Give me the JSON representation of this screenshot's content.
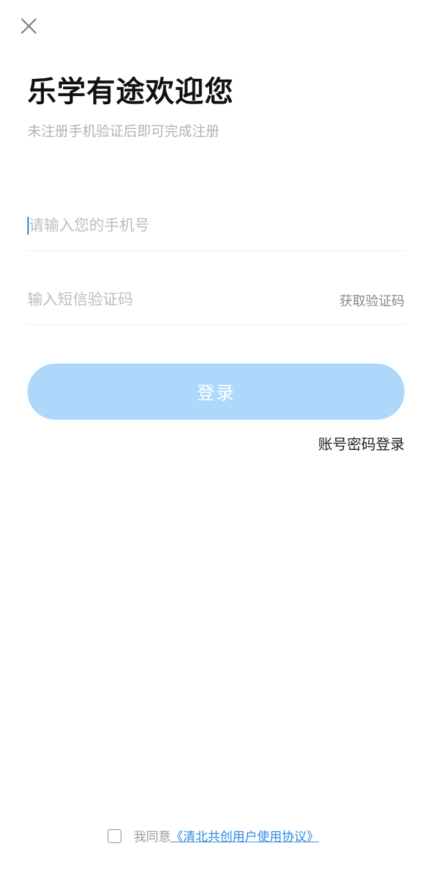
{
  "header": {
    "close_icon": "close-icon",
    "title": "乐学有途欢迎您",
    "subtitle": "未注册手机验证后即可完成注册"
  },
  "form": {
    "phone_placeholder": "请输入您的手机号",
    "phone_value": "",
    "code_placeholder": "输入短信验证码",
    "code_value": "",
    "get_code_label": "获取验证码",
    "login_label": "登录",
    "password_login_label": "账号密码登录"
  },
  "agreement": {
    "checked": false,
    "text": "我同意",
    "link_text": "《清北共创用户使用协议》"
  },
  "colors": {
    "primary_button": "#aed8fb",
    "link": "#2b8ae0",
    "caret": "#2d7be0",
    "placeholder": "#bdbdbd"
  }
}
